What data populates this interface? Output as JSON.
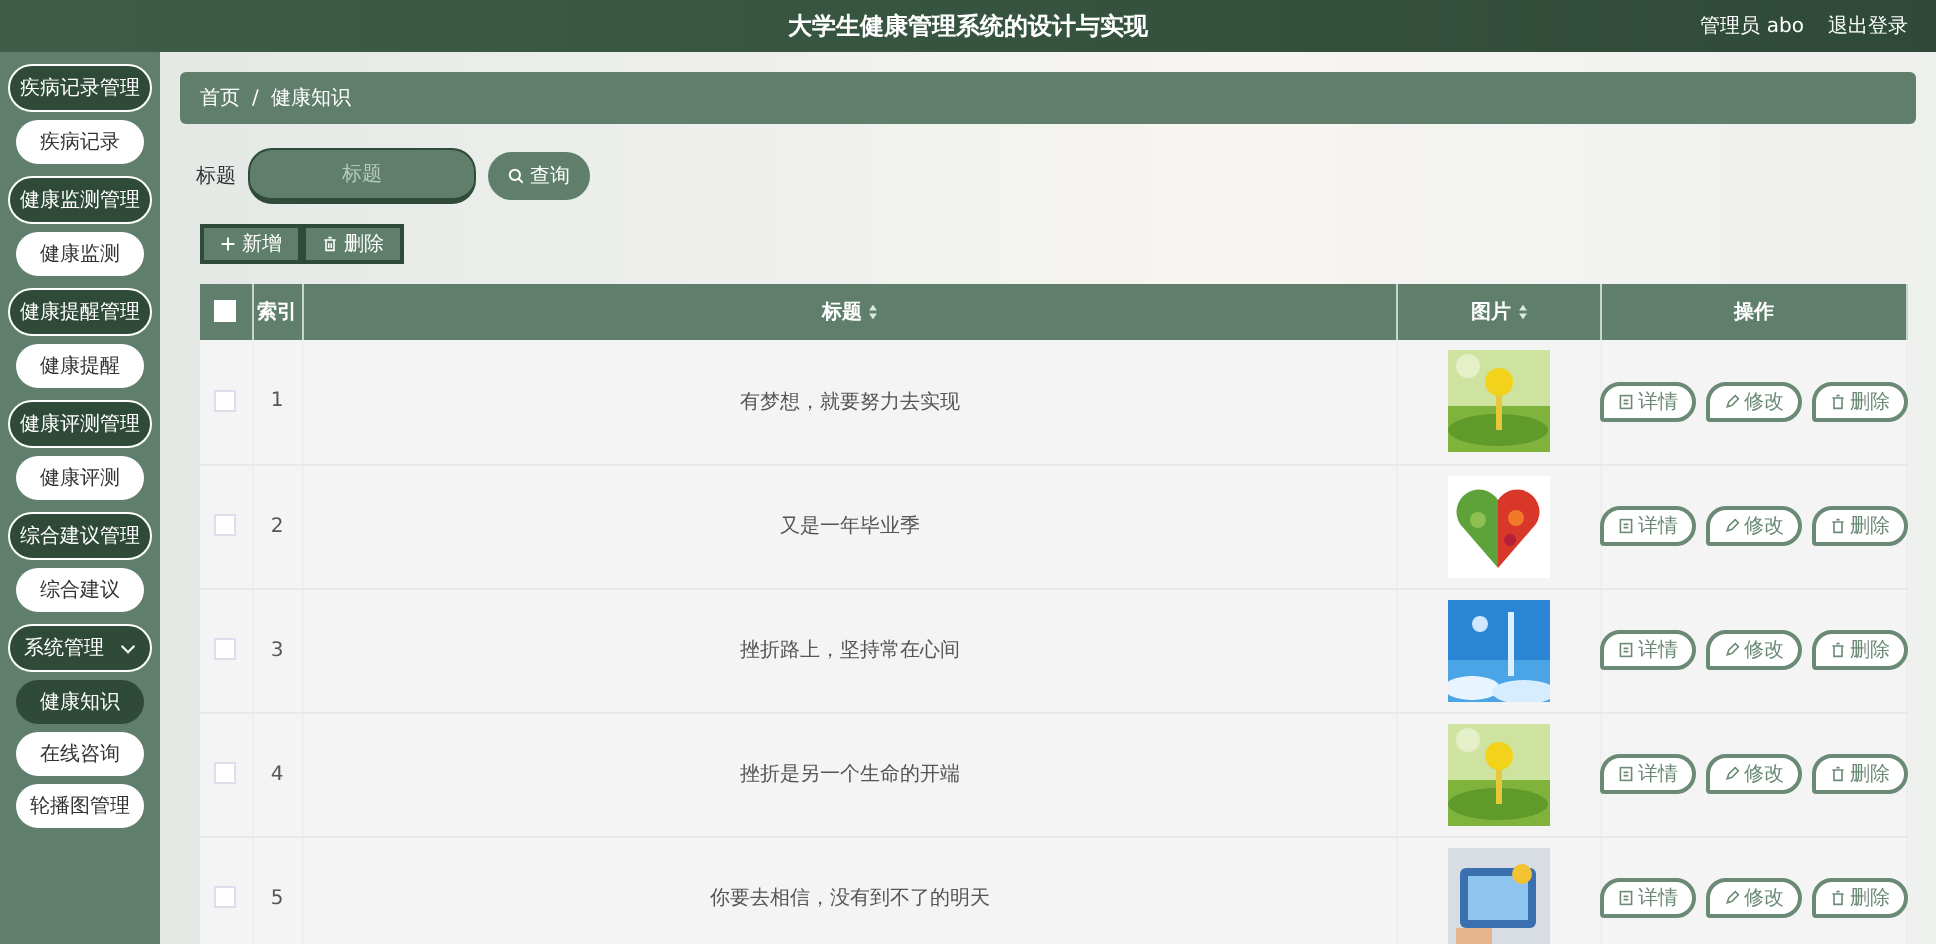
{
  "header": {
    "title": "大学生健康管理系统的设计与实现",
    "user": "管理员 abo",
    "logout": "退出登录"
  },
  "sidebar": {
    "groups": [
      {
        "label": "疾病记录管理",
        "kind": "group",
        "items": [
          {
            "label": "疾病记录",
            "selected": false
          }
        ]
      },
      {
        "label": "健康监测管理",
        "kind": "group",
        "items": [
          {
            "label": "健康监测",
            "selected": false
          }
        ]
      },
      {
        "label": "健康提醒管理",
        "kind": "group",
        "items": [
          {
            "label": "健康提醒",
            "selected": false
          }
        ]
      },
      {
        "label": "健康评测管理",
        "kind": "group",
        "items": [
          {
            "label": "健康评测",
            "selected": false
          }
        ]
      },
      {
        "label": "综合建议管理",
        "kind": "group",
        "items": [
          {
            "label": "综合建议",
            "selected": false
          }
        ]
      },
      {
        "label": "系统管理",
        "kind": "dropdown",
        "items": [
          {
            "label": "健康知识",
            "selected": true
          },
          {
            "label": "在线咨询",
            "selected": false
          },
          {
            "label": "轮播图管理",
            "selected": false
          }
        ]
      }
    ]
  },
  "breadcrumb": {
    "separator": "/",
    "items": [
      "首页",
      "健康知识"
    ]
  },
  "search": {
    "label": "标题",
    "placeholder": "标题",
    "button": "查询"
  },
  "actions": [
    "新增",
    "删除"
  ],
  "table": {
    "select_all_checked": false,
    "columns": [
      "索引",
      "标题",
      "图片",
      "操作"
    ],
    "rows": [
      {
        "index": "1",
        "title": "有梦想，就要努力去实现",
        "checked": false,
        "picture": {
          "kind": "picture"
        },
        "buttons": [
          "详情",
          "修改",
          "删除"
        ]
      },
      {
        "index": "2",
        "title": "又是一年毕业季",
        "checked": false,
        "picture": {
          "kind": "picture"
        },
        "buttons": [
          "详情",
          "修改",
          "删除"
        ]
      },
      {
        "index": "3",
        "title": "挫折路上，坚持常在心间",
        "checked": false,
        "picture": {
          "kind": "picture"
        },
        "buttons": [
          "详情",
          "修改",
          "删除"
        ]
      },
      {
        "index": "4",
        "title": "挫折是另一个生命的开端",
        "checked": false,
        "picture": {
          "kind": "picture"
        },
        "buttons": [
          "详情",
          "修改",
          "删除"
        ]
      },
      {
        "index": "5",
        "title": "你要去相信，没有到不了的明天",
        "checked": false,
        "picture": {
          "kind": "picture"
        },
        "buttons": [
          "详情",
          "修改",
          "删除"
        ]
      }
    ]
  }
}
